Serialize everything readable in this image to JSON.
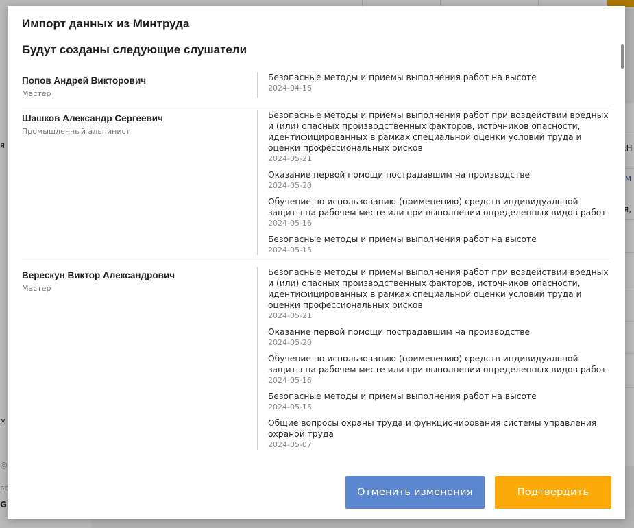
{
  "background": {
    "fragments": [
      "я",
      "ЕН",
      "м",
      "я,",
      "м",
      "@р",
      "вс",
      "G"
    ]
  },
  "modal": {
    "title": "Импорт данных из Минтруда",
    "section_title": "Будут созданы следующие слушатели",
    "people": [
      {
        "name": "Попов Андрей Викторович",
        "role": "Мастер",
        "courses": [
          {
            "title": "Безопасные методы и приемы выполнения работ на высоте",
            "date": "2024-04-16"
          }
        ]
      },
      {
        "name": "Шашков Александр Сергеевич",
        "role": "Промышленный альпинист",
        "courses": [
          {
            "title": "Безопасные методы и приемы выполнения работ при воздействии вредных и (или) опасных производственных факторов, источников опасности, идентифицированных в рамках специальной оценки условий труда и оценки профессиональных рисков",
            "date": "2024-05-21"
          },
          {
            "title": "Оказание первой помощи пострадавшим на производстве",
            "date": "2024-05-20"
          },
          {
            "title": "Обучение по использованию (применению) средств индивидуальной защиты на рабочем месте или при выполнении определенных видов работ",
            "date": "2024-05-16"
          },
          {
            "title": "Безопасные методы и приемы выполнения работ на высоте",
            "date": "2024-05-15"
          }
        ]
      },
      {
        "name": "Верескун Виктор Александрович",
        "role": "Мастер",
        "courses": [
          {
            "title": "Безопасные методы и приемы выполнения работ при воздействии вредных и (или) опасных производственных факторов, источников опасности, идентифицированных в рамках специальной оценки условий труда и оценки профессиональных рисков",
            "date": "2024-05-21"
          },
          {
            "title": "Оказание первой помощи пострадавшим на производстве",
            "date": "2024-05-20"
          },
          {
            "title": "Обучение по использованию (применению) средств индивидуальной защиты на рабочем месте или при выполнении определенных видов работ",
            "date": "2024-05-16"
          },
          {
            "title": "Безопасные методы и приемы выполнения работ на высоте",
            "date": "2024-05-15"
          },
          {
            "title": "Общие вопросы охраны труда и функционирования системы управления охраной труда",
            "date": "2024-05-07"
          }
        ]
      }
    ],
    "buttons": {
      "cancel_label": "Отменить изменения",
      "confirm_label": "Подтвердить"
    }
  },
  "colors": {
    "accent_blue": "#5a87cf",
    "accent_orange": "#fdaa08"
  }
}
